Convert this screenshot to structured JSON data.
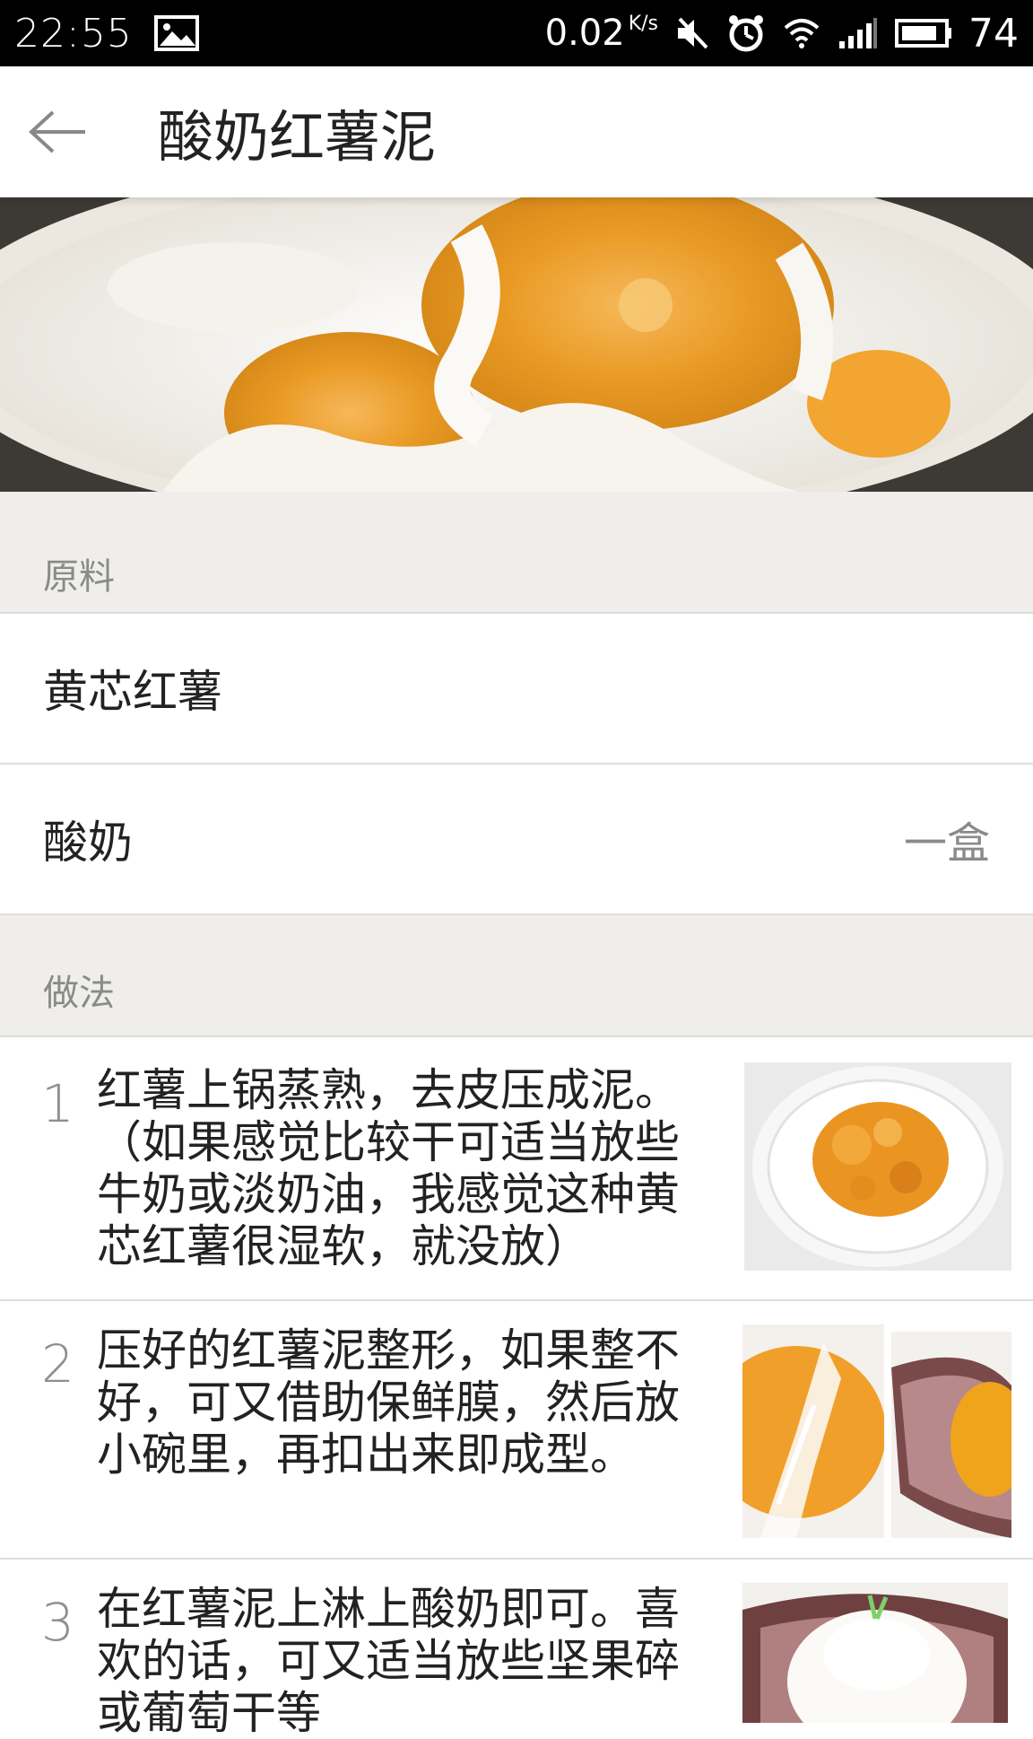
{
  "status_bar": {
    "time": "22:55",
    "speed": "0.02",
    "speed_unit": "K/s",
    "battery": "74",
    "icons": [
      "image-icon",
      "mute-icon",
      "alarm-icon",
      "wifi-icon",
      "signal-icon",
      "battery-icon"
    ]
  },
  "app_bar": {
    "title": "酸奶红薯泥",
    "back_icon": "back-arrow-icon"
  },
  "sections": {
    "ingredients_label": "原料",
    "method_label": "做法"
  },
  "ingredients": [
    {
      "name": "黄芯红薯",
      "qty": ""
    },
    {
      "name": "酸奶",
      "qty": "一盒"
    }
  ],
  "steps": [
    {
      "num": "1",
      "text": "红薯上锅蒸熟，去皮压成泥。（如果感觉比较干可适当放些牛奶或淡奶油，我感觉这种黄芯红薯很湿软，就没放）"
    },
    {
      "num": "2",
      "text": "压好的红薯泥整形，如果整不好，可又借助保鲜膜，然后放小碗里，再扣出来即成型。"
    },
    {
      "num": "3",
      "text": "在红薯泥上淋上酸奶即可。喜欢的话，可又适当放些坚果碎或葡萄干等"
    }
  ],
  "colors": {
    "section_bg": "#efeeea",
    "muted_text": "#8a8a8a",
    "sweet_potato": "#f2a531"
  }
}
